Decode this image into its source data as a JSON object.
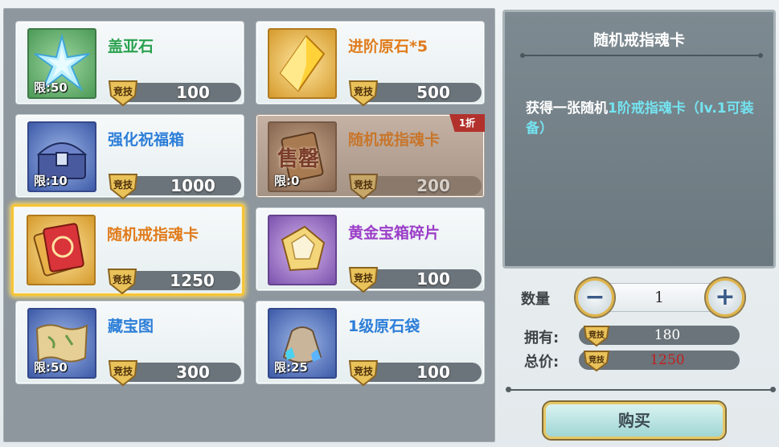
{
  "shop": {
    "items": [
      {
        "name": "盖亚石",
        "price": "100",
        "limit": "限:50",
        "currency": "竞技",
        "name_color": "#2aa24e"
      },
      {
        "name": "进阶原石*5",
        "price": "500",
        "limit": "",
        "currency": "竞技",
        "name_color": "#e07c1c"
      },
      {
        "name": "强化祝福箱",
        "price": "1000",
        "limit": "限:10",
        "currency": "竞技",
        "name_color": "#2c7ed8"
      },
      {
        "name": "随机戒指魂卡",
        "price": "200",
        "limit": "限:0",
        "currency": "竞技",
        "name_color": "#c8762c",
        "sold_label": "售罄",
        "discount": "1折"
      },
      {
        "name": "随机戒指魂卡",
        "price": "1250",
        "limit": "",
        "currency": "竞技",
        "name_color": "#e07c1c"
      },
      {
        "name": "黄金宝箱碎片",
        "price": "100",
        "limit": "",
        "currency": "竞技",
        "name_color": "#9b3ec8"
      },
      {
        "name": "藏宝图",
        "price": "300",
        "limit": "限:50",
        "currency": "竞技",
        "name_color": "#2c7ed8"
      },
      {
        "name": "1级原石袋",
        "price": "100",
        "limit": "限:25",
        "currency": "竞技",
        "name_color": "#2c7ed8"
      }
    ]
  },
  "detail": {
    "title": "随机戒指魂卡",
    "desc_prefix": "获得一张随机",
    "desc_highlight": "1阶戒指魂卡（lv.1可装备）",
    "quantity_label": "数量",
    "quantity_value": "1",
    "owned_label": "拥有:",
    "owned_value": "180",
    "total_label": "总价:",
    "total_value": "1250",
    "currency_badge": "竞技",
    "buy_label": "购买"
  },
  "colors": {
    "accent_gold": "#f4c43a",
    "price_bar": "#6b747a",
    "total_red": "#c0201e",
    "highlight_cyan": "#74e3f0"
  }
}
